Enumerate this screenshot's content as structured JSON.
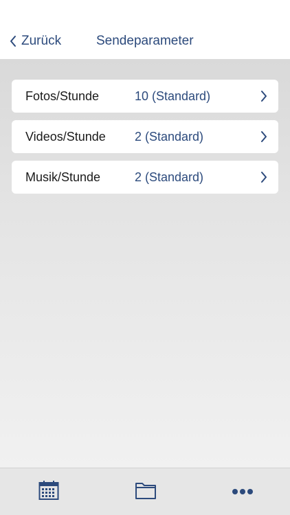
{
  "header": {
    "back_label": "Zurück",
    "title": "Sendeparameter"
  },
  "settings": [
    {
      "label": "Fotos/Stunde",
      "value": "10 (Standard)"
    },
    {
      "label": "Videos/Stunde",
      "value": "2 (Standard)"
    },
    {
      "label": "Musik/Stunde",
      "value": "2 (Standard)"
    }
  ],
  "tabbar": {
    "tabs": [
      {
        "icon": "calendar-icon"
      },
      {
        "icon": "folder-icon"
      },
      {
        "icon": "more-icon"
      }
    ]
  },
  "colors": {
    "accent": "#2c4a7c",
    "background": "#ececec",
    "tabbar": "#e6e6e6"
  }
}
